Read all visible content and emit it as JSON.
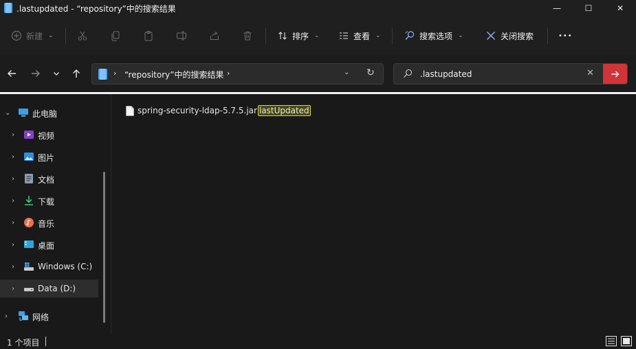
{
  "window": {
    "title": ".lastupdated - “repository”中的搜索结果",
    "minimize_glyph": "—",
    "maximize_glyph": "☐",
    "close_glyph": "✕"
  },
  "toolbar": {
    "new_label": "新建",
    "sort_label": "排序",
    "view_label": "查看",
    "search_options_label": "搜索选项",
    "close_search_label": "关闭搜索",
    "more_glyph": "•••"
  },
  "address": {
    "path_label": "“repository”中的搜索结果"
  },
  "search": {
    "value": ".lastupdated"
  },
  "sidebar": {
    "items": [
      {
        "label": "此电脑",
        "icon": "computer-icon"
      },
      {
        "label": "视频",
        "icon": "video-icon"
      },
      {
        "label": "图片",
        "icon": "pictures-icon"
      },
      {
        "label": "文档",
        "icon": "documents-icon"
      },
      {
        "label": "下载",
        "icon": "download-icon"
      },
      {
        "label": "音乐",
        "icon": "music-icon"
      },
      {
        "label": "桌面",
        "icon": "desktop-icon"
      },
      {
        "label": "Windows (C:)",
        "icon": "drive-c-icon"
      },
      {
        "label": "Data (D:)",
        "icon": "drive-d-icon"
      },
      {
        "label": "网络",
        "icon": "network-icon"
      }
    ]
  },
  "results": {
    "file_prefix": "spring-security-ldap-5.7.5.jar",
    "file_highlight": "lastUpdated"
  },
  "status": {
    "item_count": "1 个项目"
  },
  "colors": {
    "accent_red": "#d13438",
    "highlight_border": "#d8d840",
    "folder_blue": "#4aa3ef"
  }
}
